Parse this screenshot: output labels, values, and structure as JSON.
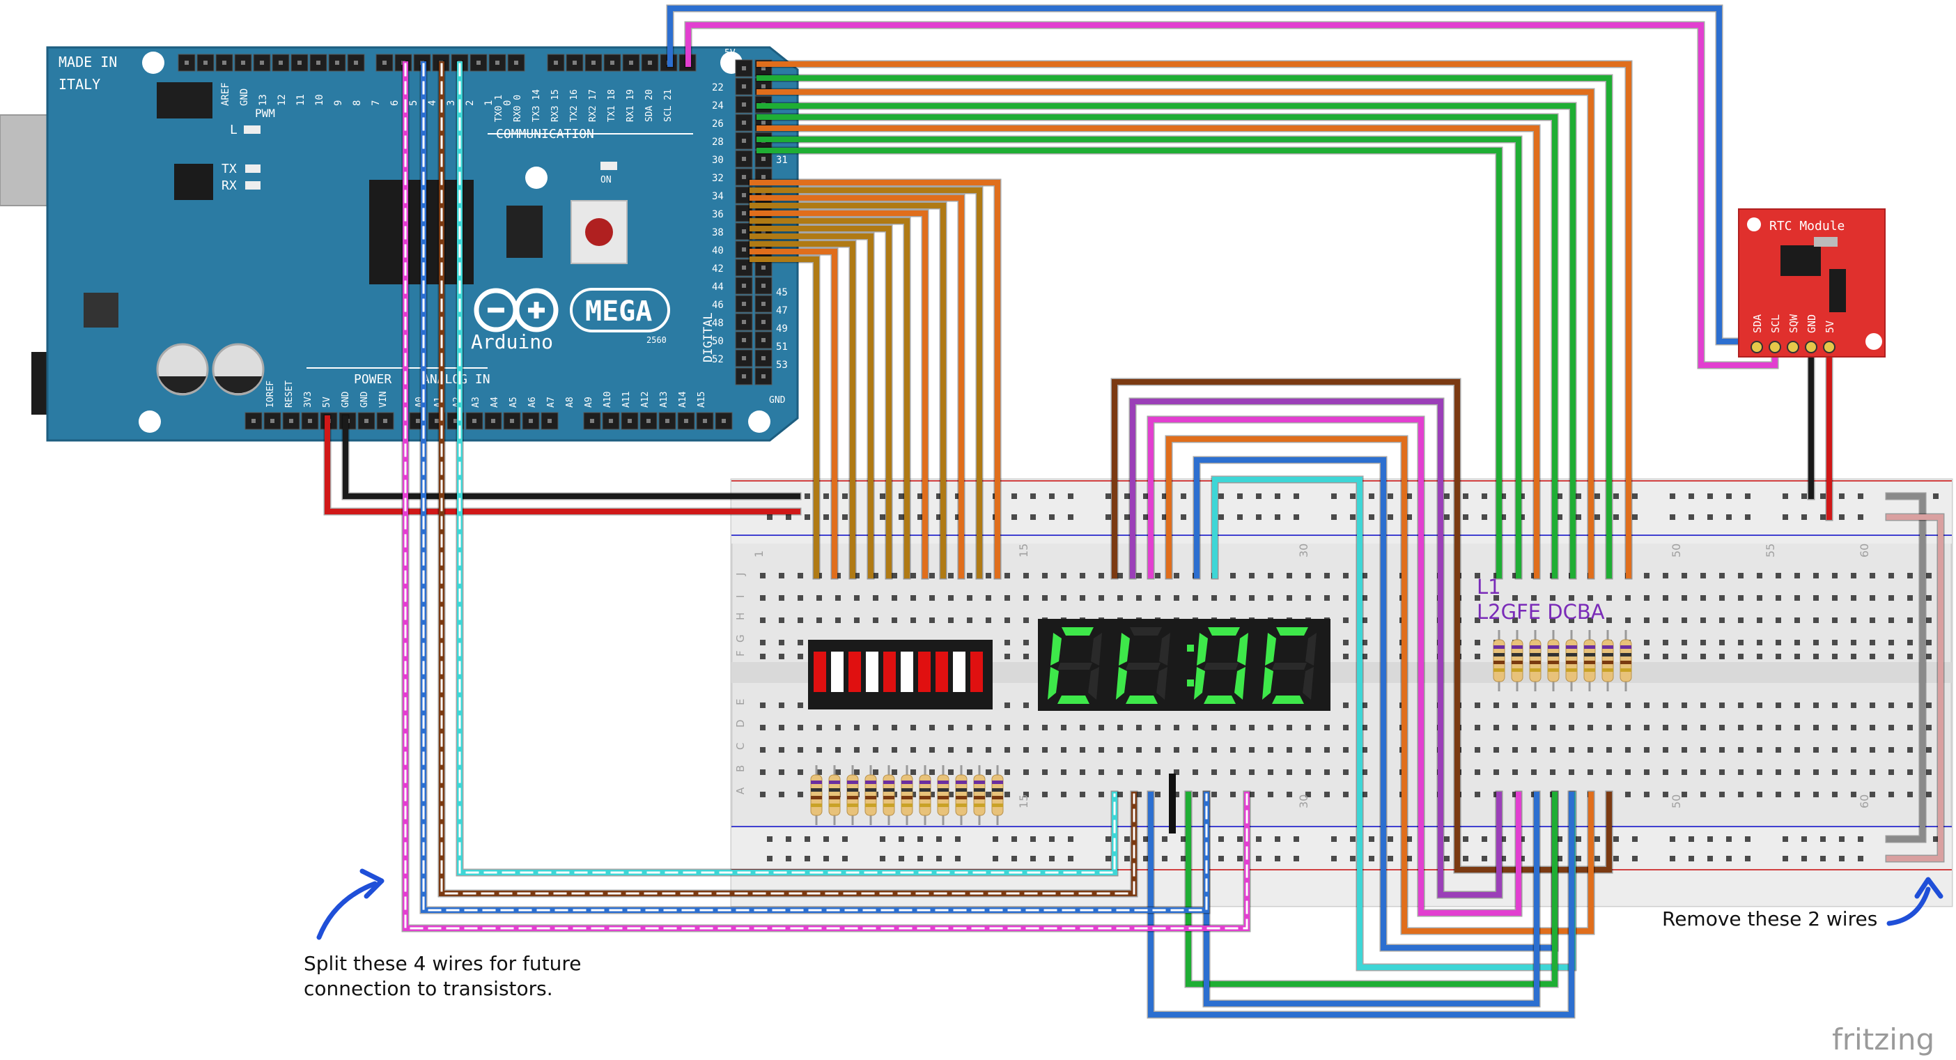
{
  "board": {
    "made_in": "MADE IN",
    "country": "ITALY",
    "model": "MEGA",
    "brand": "Arduino",
    "sub_model": "2560",
    "pwm": "PWM",
    "communication": "COMMUNICATION",
    "power": "POWER",
    "analog_in": "ANALOG IN",
    "digital": "DIGITAL",
    "led_l": "L",
    "led_tx": "TX",
    "led_rx": "RX",
    "led_on": "ON",
    "top_pins": [
      "AREF",
      "GND",
      "13",
      "12",
      "11",
      "10",
      "9",
      "8",
      "7",
      "6",
      "5",
      "4",
      "3",
      "2",
      "1",
      "0"
    ],
    "comm_pins": [
      "TX0 1",
      "RX0 0",
      "TX3 14",
      "RX3 15",
      "TX2 16",
      "RX2 17",
      "TX1 18",
      "RX1 19",
      "SDA 20",
      "SCL 21"
    ],
    "power_pins": [
      "IOREF",
      "RESET",
      "3V3",
      "5V",
      "GND",
      "GND",
      "VIN"
    ],
    "analog_pins": [
      "A0",
      "A1",
      "A2",
      "A3",
      "A4",
      "A5",
      "A6",
      "A7",
      "A8",
      "A9",
      "A10",
      "A11",
      "A12",
      "A13",
      "A14",
      "A15"
    ],
    "digital_left": [
      "22",
      "24",
      "26",
      "28",
      "30",
      "32",
      "34",
      "36",
      "38",
      "40",
      "42",
      "44",
      "46",
      "48",
      "50",
      "52"
    ],
    "digital_right": [
      "31",
      "45",
      "47",
      "49",
      "51",
      "53"
    ],
    "pin_5v": "5V",
    "pin_gnd": "GND"
  },
  "rtc": {
    "title": "RTC Module",
    "pins": [
      "SDA",
      "SCL",
      "SQW",
      "GND",
      "5V"
    ]
  },
  "breadboard": {
    "col_labels": [
      "1",
      "15",
      "30",
      "50",
      "55",
      "60"
    ],
    "row_labels_top": [
      "J",
      "I",
      "H",
      "G",
      "F"
    ],
    "row_labels_bottom": [
      "E",
      "D",
      "C",
      "B",
      "A"
    ]
  },
  "display": {
    "digits": [
      "C",
      "L",
      "O",
      "C"
    ],
    "segment_labels_line1": "L1",
    "segment_labels_line2": "L2GFE DCBA"
  },
  "annotations": {
    "split_line1": "Split these 4 wires for future",
    "split_line2": "connection to transistors.",
    "remove": "Remove these 2 wires"
  },
  "branding": "fritzing",
  "colors": {
    "board": "#2b7ba3",
    "wire_orange": "#e06e1c",
    "wire_green": "#1fae34",
    "wire_olive": "#b07a14",
    "wire_magenta": "#e23fd0",
    "wire_blue": "#2c6fd0",
    "wire_brown": "#7b3a12",
    "wire_cyan": "#3ed6d6",
    "wire_purple": "#9b3fb8",
    "rtc": "#e0302d",
    "seg_on": "#3ee84a",
    "bar_red": "#e01010"
  }
}
